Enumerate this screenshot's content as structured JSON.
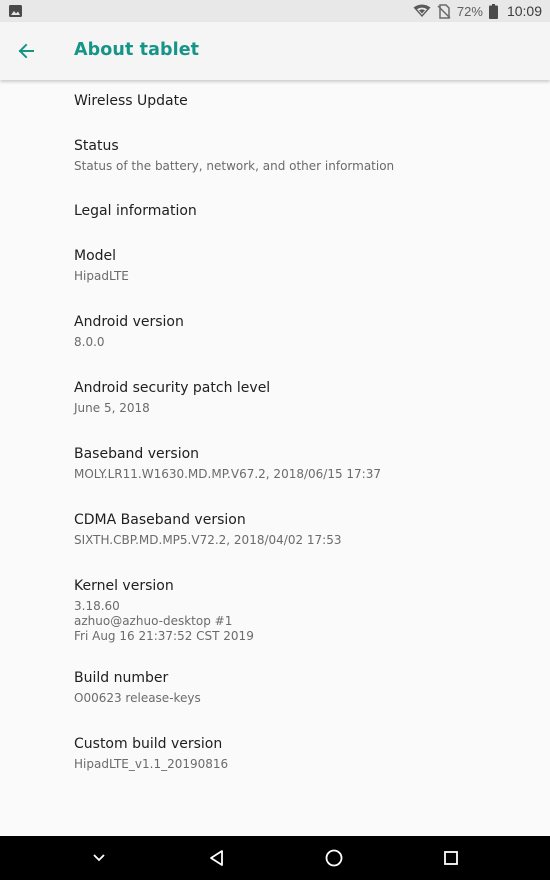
{
  "status_bar": {
    "battery_percent": "72%",
    "time": "10:09",
    "icons": [
      "image-notification-icon",
      "wifi-icon",
      "no-sim-icon",
      "battery-icon"
    ]
  },
  "app_bar": {
    "title": "About tablet",
    "back_icon": "arrow-back-icon",
    "accent_color": "#159588"
  },
  "items": [
    {
      "title": "Wireless Update"
    },
    {
      "title": "Status",
      "summary": [
        "Status of the battery, network, and other information"
      ]
    },
    {
      "title": "Legal information"
    },
    {
      "title": "Model",
      "summary": [
        "HipadLTE"
      ]
    },
    {
      "title": "Android version",
      "summary": [
        "8.0.0"
      ]
    },
    {
      "title": "Android security patch level",
      "summary": [
        "June 5, 2018"
      ]
    },
    {
      "title": "Baseband version",
      "summary": [
        "MOLY.LR11.W1630.MD.MP.V67.2, 2018/06/15 17:37"
      ]
    },
    {
      "title": "CDMA Baseband version",
      "summary": [
        "SIXTH.CBP.MD.MP5.V72.2, 2018/04/02 17:53"
      ]
    },
    {
      "title": "Kernel version",
      "summary": [
        "3.18.60",
        "azhuo@azhuo-desktop #1",
        "Fri Aug 16 21:37:52 CST 2019"
      ]
    },
    {
      "title": "Build number",
      "summary": [
        "O00623 release-keys"
      ]
    },
    {
      "title": "Custom build version",
      "summary": [
        "HipadLTE_v1.1_20190816"
      ]
    }
  ],
  "nav_bar": {
    "buttons": [
      "hide-keyboard-icon",
      "back-triangle-icon",
      "home-circle-icon",
      "recents-square-icon"
    ]
  }
}
